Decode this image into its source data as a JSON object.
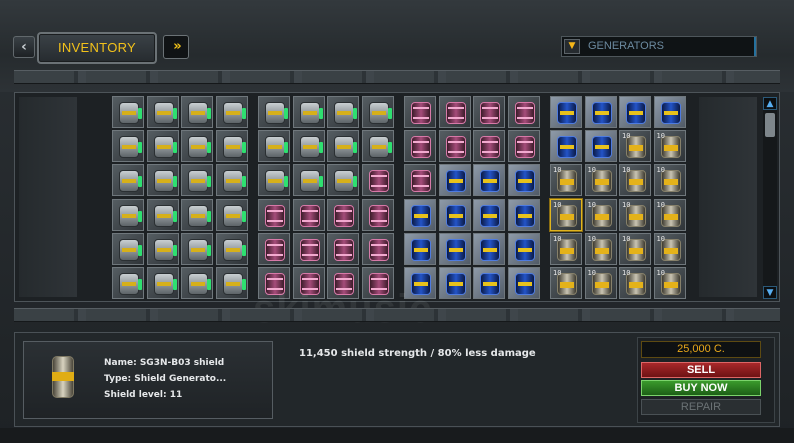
{
  "header": {
    "tab_label": "INVENTORY",
    "nav_left_glyph": "‹",
    "nav_right_glyph": "»",
    "filter_label": "GENERATORS",
    "filter_arrow": "▼"
  },
  "grid": {
    "groups": [
      {
        "type": "gen-green",
        "rows": 6,
        "cols": 4
      },
      {
        "type": "mixed-pink",
        "rows": 6,
        "cols": 4
      },
      {
        "type": "pink-blue",
        "rows": 6,
        "cols": 4
      },
      {
        "type": "blue-gold",
        "rows": 6,
        "cols": 4
      }
    ],
    "level_tag": "10",
    "watermark": "skimusic"
  },
  "scrollbar": {
    "up_glyph": "▲",
    "down_glyph": "▼"
  },
  "details": {
    "name_line": "Name: SG3N-B03 shield",
    "type_line": "Type: Shield Generato...",
    "level_line": "Shield level: 11",
    "description": "11,450 shield strength / 80% less damage"
  },
  "actions": {
    "price": "25,000 C.",
    "sell_label": "SELL",
    "buy_label": "BUY NOW",
    "repair_label": "REPAIR"
  },
  "colors": {
    "accent": "#f3c21a",
    "sell": "#a8282a",
    "buy": "#3a9a2c"
  }
}
